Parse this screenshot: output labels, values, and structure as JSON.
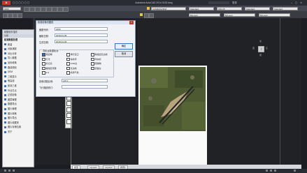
{
  "window": {
    "app_title": "Autodesk AutoCAD 2014",
    "file_name": "0152.dwg",
    "signin": "登录"
  },
  "ribbon": {
    "workspace": "0152",
    "layer": "CAMERAVIEW",
    "style1": "Standard",
    "style2": "ISO-25",
    "style3": "Standard",
    "style4": "Standard",
    "bylayer1": "ByLayer",
    "bylayer2": "ByLayer",
    "bylayer3": "ByLayer"
  },
  "palette": {
    "header": "超图软件插件",
    "tabs": "功能",
    "section": "航测数据处理",
    "items": [
      "新建",
      "对象捕捉",
      "对比分析",
      "导入数据",
      "坐标转换",
      "路线规划",
      "DEM",
      "三维显示",
      "等高线",
      "航测三维",
      "外业打点",
      "正射影像",
      "图层管理",
      "数据导出",
      "图片管理",
      "图片转换",
      "图片导出",
      "图片收藏夹",
      "图片存储位置",
      "关于"
    ]
  },
  "dialog": {
    "title": "机场影像切图检",
    "fields": [
      {
        "label": "截图代码:",
        "value": "0152"
      },
      {
        "label": "截取日期:",
        "value": "2019-01-06"
      },
      {
        "label": "生成日期:",
        "value": "2019-01-06"
      }
    ],
    "group_title": "导航台数据检测",
    "checkboxes": [
      {
        "label": "跑道端",
        "checked": true
      },
      {
        "label": "滑行道口",
        "checked": false
      },
      {
        "label": "联络道及边线",
        "checked": false
      },
      {
        "label": "灯光",
        "checked": false
      },
      {
        "label": "停机坪",
        "checked": false
      },
      {
        "label": "风向标",
        "checked": false
      },
      {
        "label": "标记点",
        "checked": false
      },
      {
        "label": "VOR台",
        "checked": false
      },
      {
        "label": "障碍物",
        "checked": false
      },
      {
        "label": "着陆区测量",
        "checked": false
      },
      {
        "label": "长边线",
        "checked": false
      },
      {
        "label": "自备台",
        "checked": false
      },
      {
        "label": "ILS",
        "checked": false
      },
      {
        "label": "机场气象",
        "checked": false
      }
    ],
    "scale_label": "影像切图比例:",
    "scale_value": "125.1",
    "note_label": "飞行路线修订:",
    "ok_button": "确定",
    "cancel_button": "取消",
    "close": "×"
  },
  "viewcube": {
    "face": "上",
    "n": "北",
    "s": "南",
    "e": "东",
    "w": "西"
  },
  "layout_tabs": [
    "模型",
    "Layout1",
    "Layout2",
    "布局1"
  ]
}
